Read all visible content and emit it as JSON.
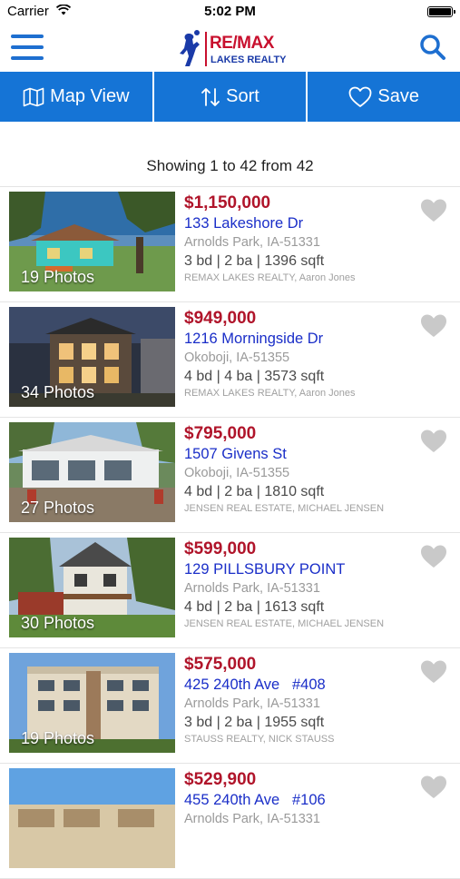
{
  "status_bar": {
    "carrier": "Carrier",
    "time": "5:02 PM"
  },
  "header": {
    "logo_text": "RE/MAX",
    "logo_subtext": "LAKES REALTY"
  },
  "toolbar": {
    "map_view_label": "Map View",
    "sort_label": "Sort",
    "save_label": "Save"
  },
  "results": {
    "summary": "Showing 1 to 42 from 42"
  },
  "colors": {
    "accent": "#1574d6",
    "price": "#b0142a",
    "address": "#1a2ec8"
  },
  "listings": [
    {
      "photos": "19 Photos",
      "price": "$1,150,000",
      "address": "133 Lakeshore Dr",
      "city": "Arnolds Park, IA-51331",
      "specs": "3 bd | 2 ba | 1396 sqft",
      "agent": "REMAX LAKES REALTY, Aaron Jones"
    },
    {
      "photos": "34 Photos",
      "price": "$949,000",
      "address": "1216 Morningside Dr",
      "city": "Okoboji, IA-51355",
      "specs": "4 bd | 4 ba | 3573 sqft",
      "agent": "REMAX LAKES REALTY, Aaron Jones"
    },
    {
      "photos": "27 Photos",
      "price": "$795,000",
      "address": "1507 Givens St",
      "city": "Okoboji, IA-51355",
      "specs": "4 bd | 2 ba | 1810 sqft",
      "agent": "JENSEN REAL ESTATE, MICHAEL JENSEN"
    },
    {
      "photos": "30 Photos",
      "price": "$599,000",
      "address": "129 PILLSBURY POINT",
      "city": "Arnolds Park, IA-51331",
      "specs": "4 bd | 2 ba | 1613 sqft",
      "agent": "JENSEN REAL ESTATE, MICHAEL JENSEN"
    },
    {
      "photos": "19 Photos",
      "price": "$575,000",
      "address": "425 240th Ave   #408",
      "city": "Arnolds Park, IA-51331",
      "specs": "3 bd | 2 ba | 1955 sqft",
      "agent": "STAUSS REALTY, NICK STAUSS"
    },
    {
      "photos": "",
      "price": "$529,900",
      "address": "455 240th Ave   #106",
      "city": "Arnolds Park, IA-51331",
      "specs": "",
      "agent": ""
    }
  ]
}
